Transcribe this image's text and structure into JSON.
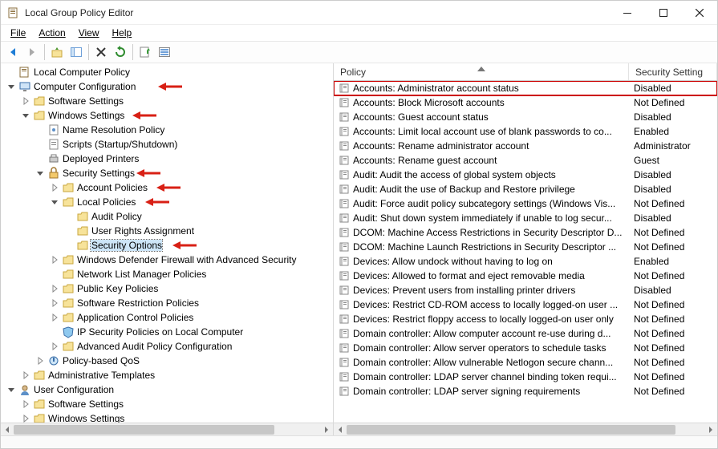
{
  "window": {
    "title": "Local Group Policy Editor"
  },
  "menu": {
    "file": "File",
    "action": "Action",
    "view": "View",
    "help": "Help"
  },
  "tree": {
    "root": "Local Computer Policy",
    "computer_config": "Computer Configuration",
    "software_settings": "Software Settings",
    "windows_settings": "Windows Settings",
    "name_resolution": "Name Resolution Policy",
    "scripts": "Scripts (Startup/Shutdown)",
    "deployed_printers": "Deployed Printers",
    "security_settings": "Security Settings",
    "account_policies": "Account Policies",
    "local_policies": "Local Policies",
    "audit_policy": "Audit Policy",
    "user_rights": "User Rights Assignment",
    "security_options": "Security Options",
    "wd_firewall": "Windows Defender Firewall with Advanced Security",
    "network_list": "Network List Manager Policies",
    "public_key": "Public Key Policies",
    "software_restriction": "Software Restriction Policies",
    "app_control": "Application Control Policies",
    "ip_security": "IP Security Policies on Local Computer",
    "advanced_audit": "Advanced Audit Policy Configuration",
    "policy_qos": "Policy-based QoS",
    "admin_templates": "Administrative Templates",
    "user_config": "User Configuration",
    "u_software_settings": "Software Settings",
    "u_windows_settings": "Windows Settings"
  },
  "list": {
    "header_policy": "Policy",
    "header_setting": "Security Setting",
    "rows": [
      {
        "name": "Accounts: Administrator account status",
        "setting": "Disabled"
      },
      {
        "name": "Accounts: Block Microsoft accounts",
        "setting": "Not Defined"
      },
      {
        "name": "Accounts: Guest account status",
        "setting": "Disabled"
      },
      {
        "name": "Accounts: Limit local account use of blank passwords to co...",
        "setting": "Enabled"
      },
      {
        "name": "Accounts: Rename administrator account",
        "setting": "Administrator"
      },
      {
        "name": "Accounts: Rename guest account",
        "setting": "Guest"
      },
      {
        "name": "Audit: Audit the access of global system objects",
        "setting": "Disabled"
      },
      {
        "name": "Audit: Audit the use of Backup and Restore privilege",
        "setting": "Disabled"
      },
      {
        "name": "Audit: Force audit policy subcategory settings (Windows Vis...",
        "setting": "Not Defined"
      },
      {
        "name": "Audit: Shut down system immediately if unable to log secur...",
        "setting": "Disabled"
      },
      {
        "name": "DCOM: Machine Access Restrictions in Security Descriptor D...",
        "setting": "Not Defined"
      },
      {
        "name": "DCOM: Machine Launch Restrictions in Security Descriptor ...",
        "setting": "Not Defined"
      },
      {
        "name": "Devices: Allow undock without having to log on",
        "setting": "Enabled"
      },
      {
        "name": "Devices: Allowed to format and eject removable media",
        "setting": "Not Defined"
      },
      {
        "name": "Devices: Prevent users from installing printer drivers",
        "setting": "Disabled"
      },
      {
        "name": "Devices: Restrict CD-ROM access to locally logged-on user ...",
        "setting": "Not Defined"
      },
      {
        "name": "Devices: Restrict floppy access to locally logged-on user only",
        "setting": "Not Defined"
      },
      {
        "name": "Domain controller: Allow computer account re-use during d...",
        "setting": "Not Defined"
      },
      {
        "name": "Domain controller: Allow server operators to schedule tasks",
        "setting": "Not Defined"
      },
      {
        "name": "Domain controller: Allow vulnerable Netlogon secure chann...",
        "setting": "Not Defined"
      },
      {
        "name": "Domain controller: LDAP server channel binding token requi...",
        "setting": "Not Defined"
      },
      {
        "name": "Domain controller: LDAP server signing requirements",
        "setting": "Not Defined"
      }
    ]
  }
}
